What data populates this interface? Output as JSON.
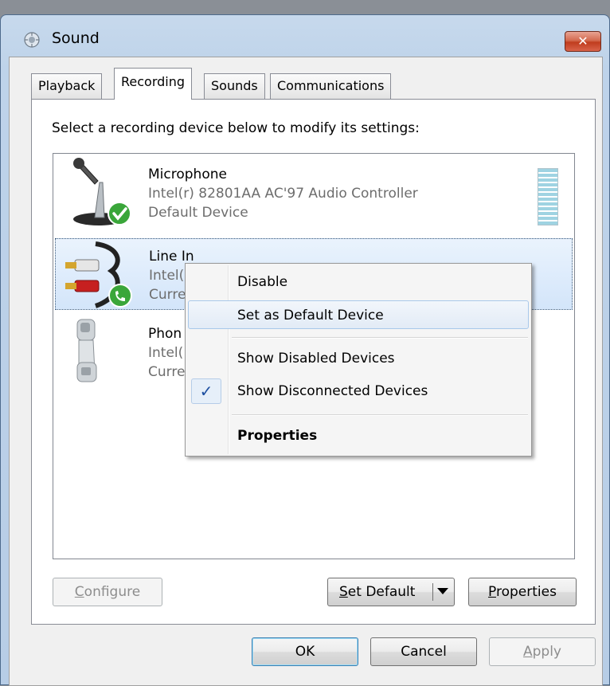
{
  "window": {
    "title": "Sound",
    "close_glyph": "✕"
  },
  "tabs": [
    {
      "label": "Playback",
      "active": false
    },
    {
      "label": "Recording",
      "active": true
    },
    {
      "label": "Sounds",
      "active": false
    },
    {
      "label": "Communications",
      "active": false
    }
  ],
  "instruction": "Select a recording device below to modify its settings:",
  "devices": [
    {
      "name": "Microphone",
      "description": "Intel(r) 82801AA AC'97 Audio Controller",
      "status": "Default Device",
      "icon": "microphone-icon",
      "badge": "green-check-badge"
    },
    {
      "name": "Line In",
      "description": "Intel(",
      "status": "Curre",
      "icon": "line-in-cable-icon",
      "badge": "green-phone-badge",
      "selected": true
    },
    {
      "name": "Phon",
      "description": "Intel(",
      "status": "Curre",
      "icon": "telephone-handset-icon"
    }
  ],
  "context_menu": {
    "items": [
      {
        "label": "Disable"
      },
      {
        "label": "Set as Default Device",
        "highlighted": true
      },
      {
        "label": "Show Disabled Devices"
      },
      {
        "label": "Show Disconnected Devices",
        "checked": true
      },
      {
        "label": "Properties",
        "bold": true
      }
    ],
    "check_glyph": "✓"
  },
  "buttons": {
    "configure": {
      "label_mnemonic": "C",
      "label_rest": "onfigure",
      "enabled": false
    },
    "set_default": {
      "label_mnemonic": "S",
      "label_rest": "et Default"
    },
    "properties": {
      "label_mnemonic": "P",
      "label_rest": "roperties"
    },
    "ok": "OK",
    "cancel": "Cancel",
    "apply": {
      "label_mnemonic": "A",
      "label_rest": "pply",
      "enabled": false
    }
  },
  "colors": {
    "selection": "#d3e5fa",
    "check_badge": "#3aa63a",
    "titlebar": "#bed3ea"
  }
}
